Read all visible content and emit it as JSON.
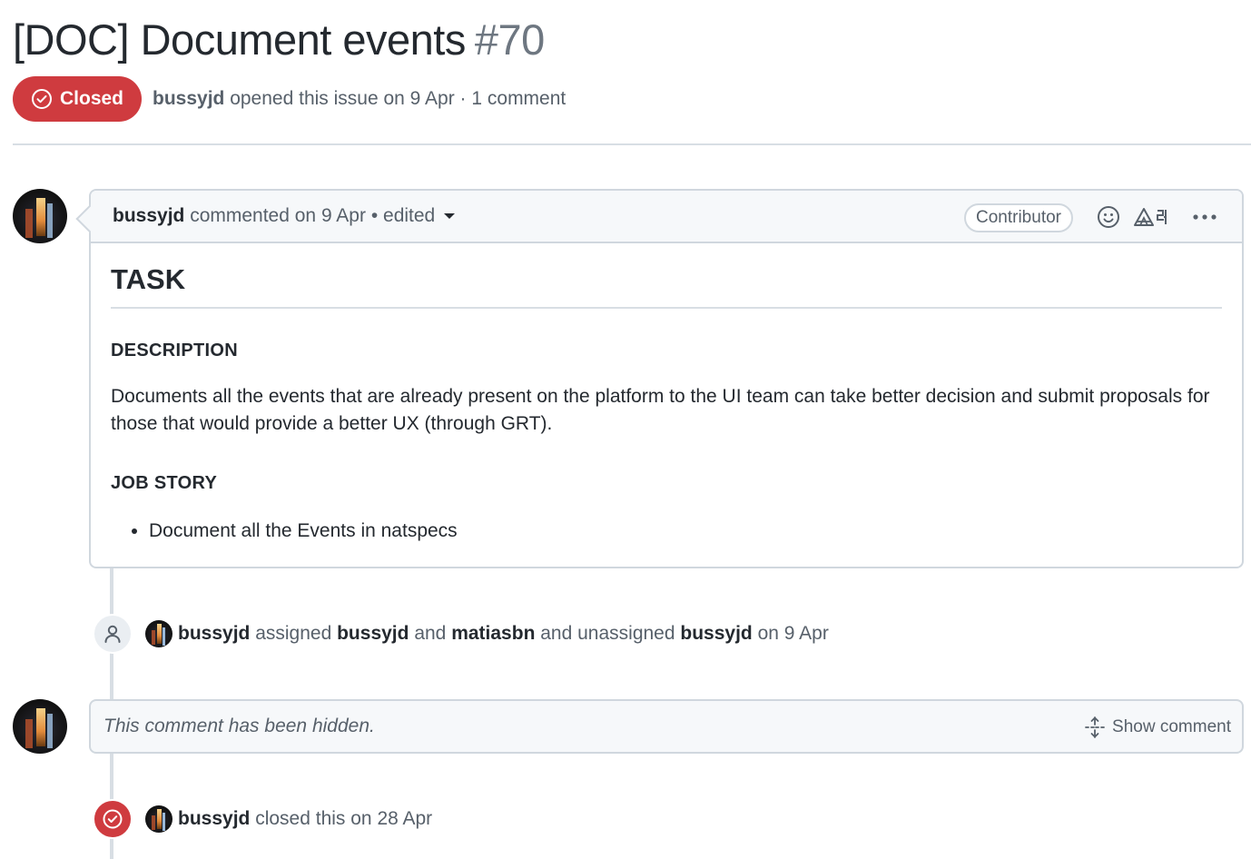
{
  "issue": {
    "title": "[DOC] Document events",
    "number": "#70",
    "state": "Closed",
    "meta_author": "bussyjd",
    "meta_text": "opened this issue on 9 Apr · 1 comment"
  },
  "comment": {
    "author": "bussyjd",
    "action": "commented on 9 Apr",
    "edited_text": "• edited",
    "role_badge": "Contributor",
    "heading": "TASK",
    "desc_heading": "DESCRIPTION",
    "desc_text": "Documents all the events that are already present on the platform to the UI team can take better decision and submit proposals for those that would provide a better UX (through GRT).",
    "job_heading": "JOB STORY",
    "job_items": [
      "Document all the Events in natspecs"
    ]
  },
  "assign_event": {
    "actor": "bussyjd",
    "t1": "assigned",
    "user1": "bussyjd",
    "t2": "and",
    "user2": "matiasbn",
    "t3": "and unassigned",
    "user3": "bussyjd",
    "t4": "on 9 Apr"
  },
  "hidden_comment": {
    "text": "This comment has been hidden.",
    "show_label": "Show comment"
  },
  "close_event": {
    "actor": "bussyjd",
    "text": "closed this on 28 Apr"
  },
  "icons": {
    "state": "check-circle-icon",
    "emoji": "smiley-icon",
    "translate": "translate-icon",
    "more": "kebab-horizontal-icon",
    "assign": "person-icon",
    "unfold": "unfold-icon",
    "closed": "check-circle-icon"
  },
  "colors": {
    "closed_red": "#cf3b3f",
    "muted_text": "#57606a",
    "border": "#d0d7de"
  }
}
